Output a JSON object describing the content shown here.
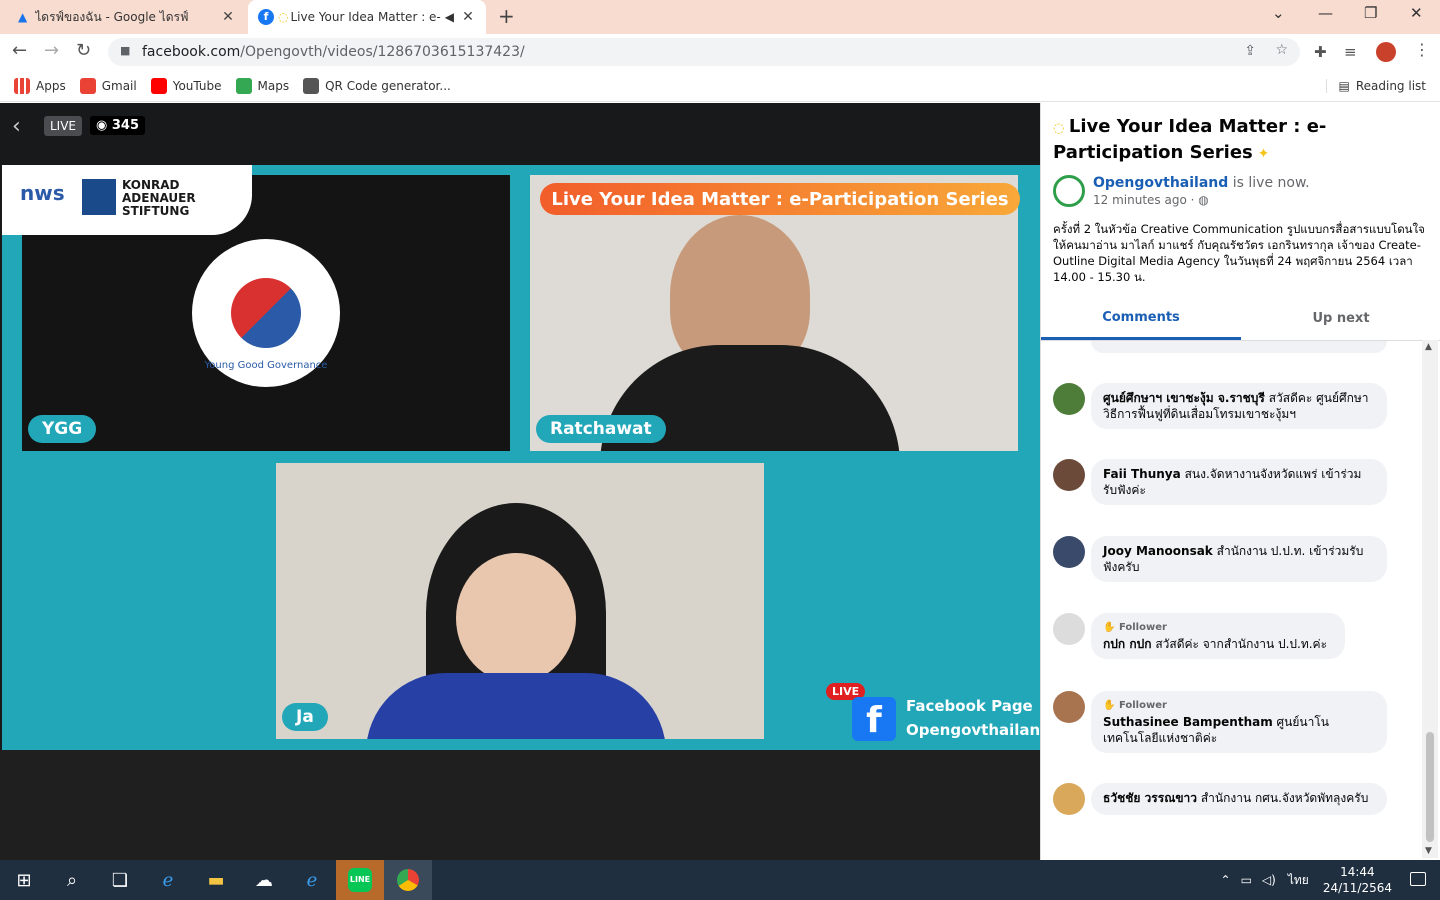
{
  "browser": {
    "tabs": [
      {
        "title": "ไดรฟ์ของฉัน - Google ไดรฟ์"
      },
      {
        "title": "Live Your Idea Matter : e-P"
      }
    ],
    "url_host": "facebook.com",
    "url_path": "/Opengovth/videos/1286703615137423/",
    "bookmarks": [
      "Apps",
      "Gmail",
      "YouTube",
      "Maps",
      "QR Code generator..."
    ],
    "reading_list": "Reading list"
  },
  "video": {
    "live_label": "LIVE",
    "views": "345",
    "banner": "Live Your Idea Matter : e-Participation Series",
    "logo_nws": "nws",
    "logo_kas": "KONRAD ADENAUER STIFTUNG",
    "ygg_text": "Young Good Governance",
    "names": [
      "YGG",
      "Ratchawat",
      "Ja"
    ],
    "fb_live": "LIVE",
    "fb_line1": "Facebook Page",
    "fb_line2": "Opengovthailand"
  },
  "side": {
    "title": "Live Your Idea Matter : e-Participation Series",
    "page_name": "Opengovthailand",
    "status": "is live now.",
    "time": "12 minutes ago ·",
    "description": "ครั้งที่ 2 ในหัวข้อ Creative Communication รูปแบบกรสื่อสารแบบโดนใจให้คนมาอ่าน มาไลก์ มาแชร์ กับคุณรัชวัตร เอกรินทรากุล เจ้าของ Create-Outline Digital Media Agency ในวันพุธที่ 24 พฤศจิกายน 2564 เวลา 14.00 - 15.30 น.",
    "tab_comments": "Comments",
    "tab_upnext": "Up next",
    "comments": [
      {
        "name": "ศูนย์ศึกษาฯ เขาชะงุ้ม จ.ราชบุรี",
        "text": "สวัสดีคะ ศูนย์ศึกษาวิธีการฟื้นฟูที่ดินเสื่อมโทรมเขาชะงุ้มฯ",
        "badge": ""
      },
      {
        "name": "Faii Thunya",
        "text": "สนง.จัดหางานจังหวัดแพร่ เข้าร่วมรับฟังค่ะ",
        "badge": ""
      },
      {
        "name": "Jooy Manoonsak",
        "text": "สำนักงาน ป.ป.ท. เข้าร่วมรับฟังครับ",
        "badge": ""
      },
      {
        "name": "กปก กปก",
        "text": "สวัสดีค่ะ จากสำนักงาน ป.ป.ท.ค่ะ",
        "badge": "Follower"
      },
      {
        "name": "Suthasinee Bampentham",
        "text": "ศูนย์นาโนเทคโนโลยีแห่งชาติค่ะ",
        "badge": "Follower"
      },
      {
        "name": "ธวัชชัย วรรณขาว",
        "text": "สำนักงาน กศน.จังหวัดพัทลุงครับ",
        "badge": ""
      }
    ]
  },
  "taskbar": {
    "lang": "ไทย",
    "time": "14:44",
    "date": "24/11/2564"
  },
  "colors": {
    "fb_blue": "#1a5fb4",
    "video_teal": "#22a7b8",
    "tab_bar": "#f8dcd0"
  }
}
